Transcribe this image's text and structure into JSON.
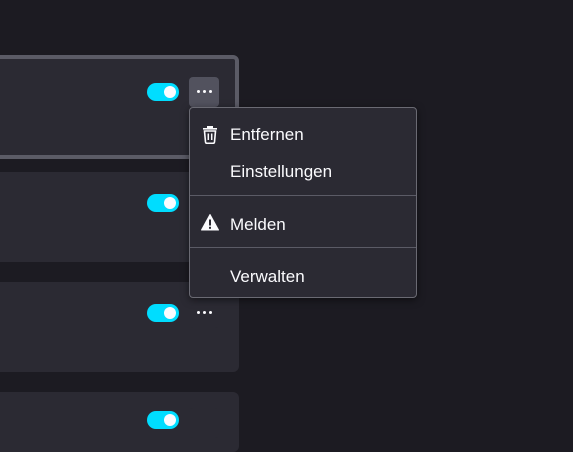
{
  "colors": {
    "background": "#1c1b22",
    "card": "#2b2a33",
    "accent_toggle": "#00ddff",
    "menu_border": "#6a6a73",
    "text": "#fbfbfe"
  },
  "cards": [
    {
      "enabled": true,
      "menu_open": true
    },
    {
      "enabled": true,
      "menu_open": false
    },
    {
      "enabled": true,
      "menu_open": false
    },
    {
      "enabled": true,
      "menu_open": false
    }
  ],
  "context_menu": {
    "items": [
      {
        "label": "Entfernen",
        "icon": "trash-icon"
      },
      {
        "label": "Einstellungen",
        "icon": ""
      },
      {
        "label": "Melden",
        "icon": "warning-icon"
      },
      {
        "label": "Verwalten",
        "icon": ""
      }
    ]
  }
}
